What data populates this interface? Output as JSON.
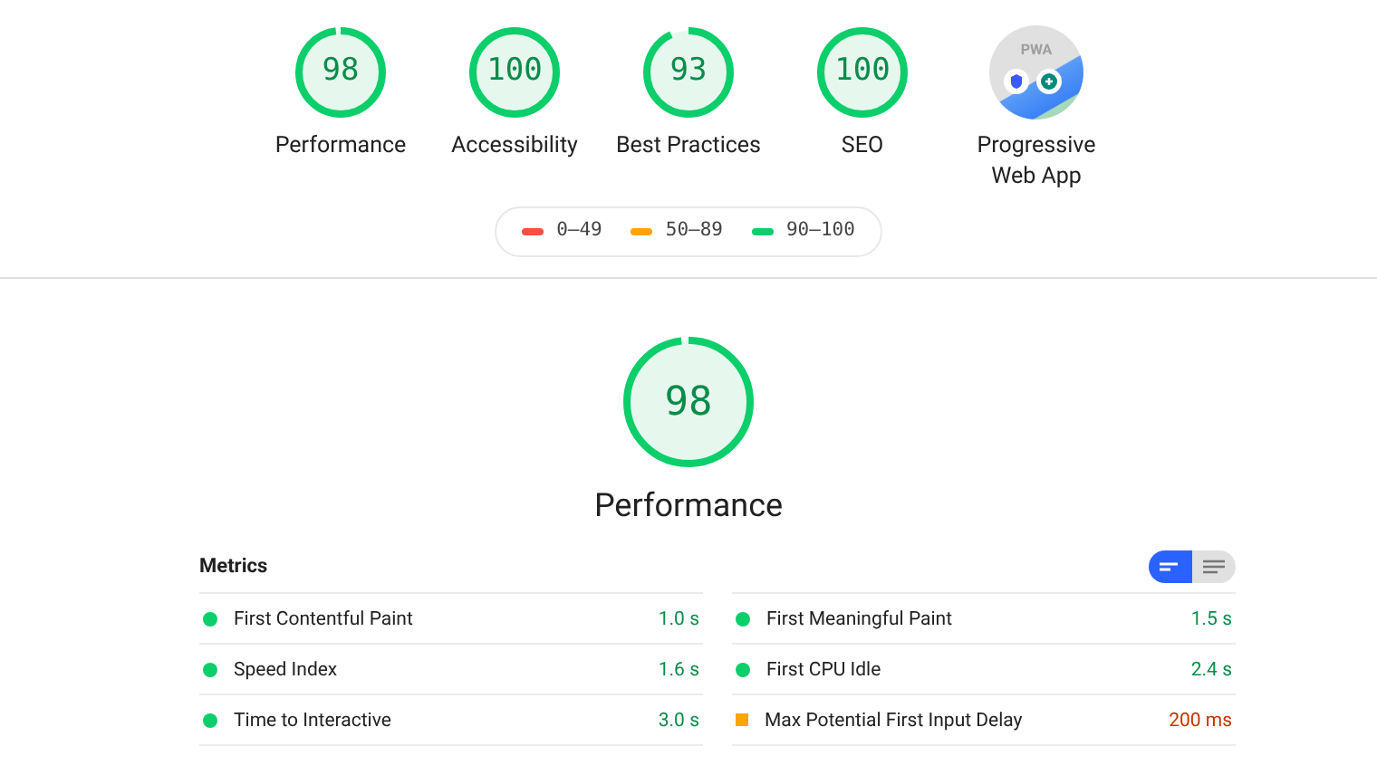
{
  "gauges": [
    {
      "kind": "score",
      "score": "98",
      "label": "Performance"
    },
    {
      "kind": "score",
      "score": "100",
      "label": "Accessibility"
    },
    {
      "kind": "score",
      "score": "93",
      "label": "Best Practices"
    },
    {
      "kind": "score",
      "score": "100",
      "label": "SEO"
    },
    {
      "kind": "pwa",
      "badge_text": "PWA",
      "label": "Progressive Web App"
    }
  ],
  "legend": [
    {
      "range": "0–49",
      "color": "#ff4e42"
    },
    {
      "range": "50–89",
      "color": "#ffa400"
    },
    {
      "range": "90–100",
      "color": "#0cce6b"
    }
  ],
  "category": {
    "score": "98",
    "title": "Performance"
  },
  "metrics": {
    "title": "Metrics",
    "view_toggle": [
      {
        "kind": "summary",
        "selected": true
      },
      {
        "kind": "list",
        "selected": false
      }
    ],
    "items": [
      {
        "name": "First Contentful Paint",
        "value": "1.0 s",
        "kind": "pass"
      },
      {
        "name": "First Meaningful Paint",
        "value": "1.5 s",
        "kind": "pass"
      },
      {
        "name": "Speed Index",
        "value": "1.6 s",
        "kind": "pass"
      },
      {
        "name": "First CPU Idle",
        "value": "2.4 s",
        "kind": "pass"
      },
      {
        "name": "Time to Interactive",
        "value": "3.0 s",
        "kind": "pass"
      },
      {
        "name": "Max Potential First Input Delay",
        "value": "200 ms",
        "kind": "average"
      }
    ]
  }
}
